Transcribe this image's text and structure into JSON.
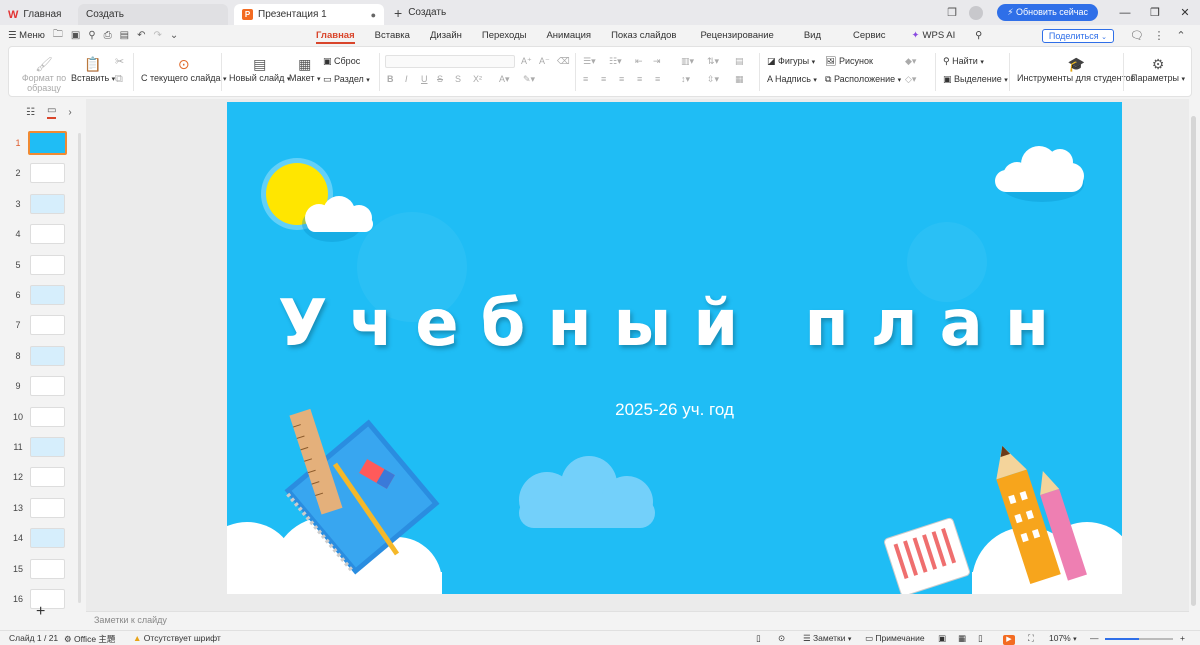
{
  "titlebar": {
    "home_tab": "Главная",
    "create_tab": "Создать",
    "doc_tab": "Презентация 1",
    "new_tab": "Создать",
    "update_button": "Обновить сейчас"
  },
  "menubar": {
    "menu_label": "Меню",
    "tabs": [
      "Главная",
      "Вставка",
      "Дизайн",
      "Переходы",
      "Анимация",
      "Показ слайдов",
      "Рецензирование",
      "Вид",
      "Сервис",
      "WPS AI"
    ],
    "share_button": "Поделиться"
  },
  "ribbon": {
    "format_painter": "Формат по образцу",
    "paste": "Вставить",
    "from_current": "С текущего слайда",
    "new_slide": "Новый слайд",
    "layout": "Макет",
    "reset": "Сброс",
    "section": "Раздел",
    "shapes": "Фигуры",
    "picture": "Рисунок",
    "textbox": "Надпись",
    "arrange": "Расположение",
    "find": "Найти",
    "select": "Выделение",
    "student_tools": "Инструменты для студентов",
    "parameters": "Параметры"
  },
  "slides_panel": {
    "numbers": [
      "1",
      "2",
      "3",
      "4",
      "5",
      "6",
      "7",
      "8",
      "9",
      "10",
      "11",
      "12",
      "13",
      "14",
      "15",
      "16"
    ],
    "active_index": 1
  },
  "slide": {
    "title": "Учебный план",
    "subtitle": "2025-26 уч. год",
    "background": "#1fbdf5"
  },
  "notes": {
    "placeholder": "Заметки к слайду"
  },
  "statusbar": {
    "slide_counter": "Слайд 1 / 21",
    "theme": "Office 主題",
    "font_warning": "Отсутствует шрифт",
    "notes": "Заметки",
    "comment": "Примечание",
    "zoom": "107%"
  },
  "colors": {
    "accent": "#d9452b",
    "brand_blue": "#2f6fe8",
    "slide_blue": "#1fbdf5"
  }
}
